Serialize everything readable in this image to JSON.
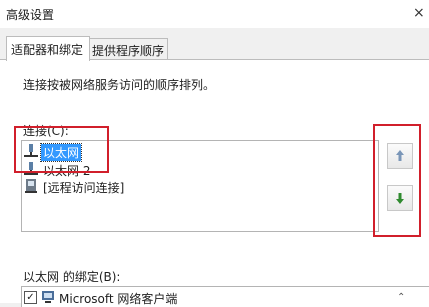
{
  "window": {
    "title": "高级设置",
    "close_glyph": "×"
  },
  "tabs": [
    {
      "label": "适配器和绑定",
      "active": true
    },
    {
      "label": "提供程序顺序",
      "active": false
    }
  ],
  "adapters_page": {
    "description": "连接按被网络服务访问的顺序排列。",
    "connections_label": "连接(C):",
    "connections": [
      {
        "label": "以太网",
        "icon": "network-adapter-icon",
        "selected": true
      },
      {
        "label": "以太网 2",
        "icon": "network-adapter-icon",
        "selected": false
      },
      {
        "label": "[远程访问连接]",
        "icon": "remote-access-icon",
        "selected": false
      }
    ],
    "move_up_icon": "arrow-up-icon",
    "move_down_icon": "arrow-down-icon",
    "bindings_label": "以太网 的绑定(B):",
    "bindings": [
      {
        "label": "Microsoft 网络客户端",
        "checked": true,
        "icon": "network-client-icon"
      }
    ]
  },
  "colors": {
    "highlight_box": "#d11f2b",
    "selection": "#3399ff",
    "arrow_up": "#7a96b8",
    "arrow_down": "#2f8a2f"
  }
}
